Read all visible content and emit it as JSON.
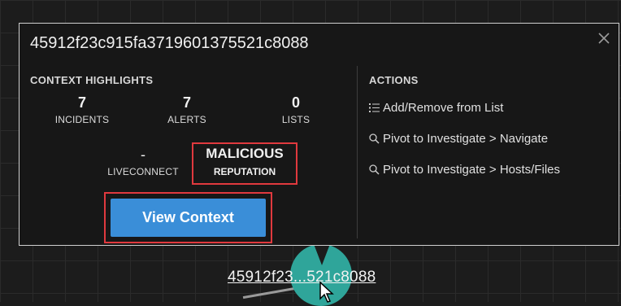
{
  "popup": {
    "title": "45912f23c915fa3719601375521c8088",
    "context_heading": "CONTEXT HIGHLIGHTS",
    "actions_heading": "ACTIONS",
    "stats": [
      {
        "value": "7",
        "label": "INCIDENTS"
      },
      {
        "value": "7",
        "label": "ALERTS"
      },
      {
        "value": "0",
        "label": "LISTS"
      },
      {
        "value": "-",
        "label": "LIVECONNECT"
      }
    ],
    "reputation": {
      "value": "MALICIOUS",
      "label": "REPUTATION"
    },
    "view_context_label": "View Context",
    "actions": [
      {
        "label": "Add/Remove from List",
        "icon": "list-icon"
      },
      {
        "label": "Pivot to Investigate > Navigate",
        "icon": "search-icon"
      },
      {
        "label": "Pivot to Investigate > Hosts/Files",
        "icon": "search-icon"
      }
    ]
  },
  "graph": {
    "node_label": "45912f23...521c8088"
  },
  "colors": {
    "highlight": "#e0393e",
    "button": "#3a8ed8",
    "node": "#2fa59a"
  }
}
